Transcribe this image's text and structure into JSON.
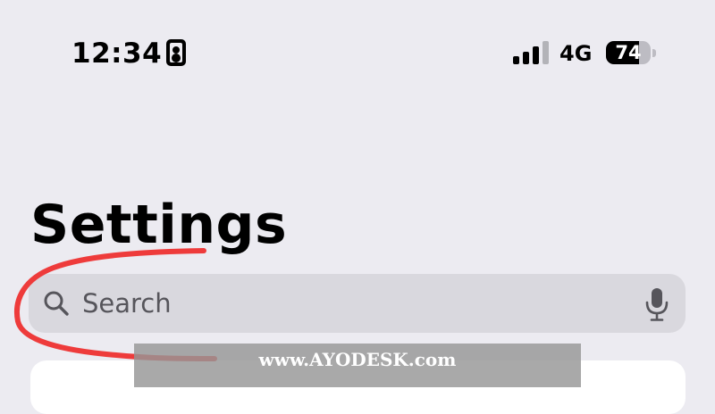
{
  "status_bar": {
    "time": "12:34",
    "network": "4G",
    "battery_percent": "74",
    "battery_level": 0.74,
    "signal_bars": 3,
    "signal_bars_total": 4
  },
  "page": {
    "title": "Settings"
  },
  "search": {
    "placeholder": "Search"
  },
  "icons": {
    "focus": "person-badge-icon",
    "signal": "cellular-signal-icon",
    "battery": "battery-icon",
    "search": "magnifying-glass-icon",
    "mic": "microphone-icon"
  },
  "colors": {
    "background": "#ecebf1",
    "search_field": "#d9d8de",
    "annotation_stroke": "#ee3b3b"
  },
  "watermark": {
    "text": "www.AYODESK.com"
  }
}
